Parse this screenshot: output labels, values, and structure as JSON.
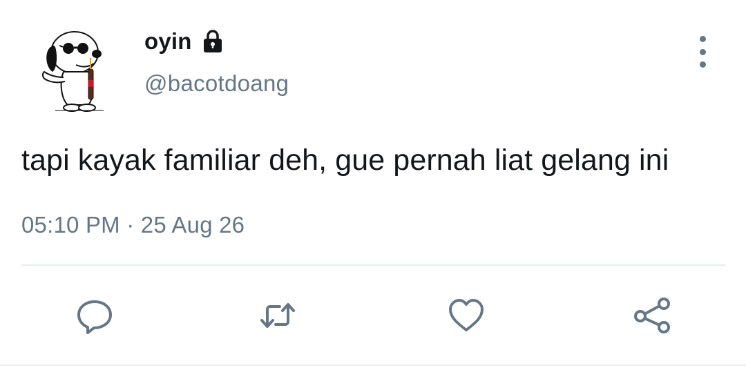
{
  "tweet": {
    "author": {
      "display_name": "oyin",
      "handle": "@bacotdoang",
      "protected": true,
      "avatar_icon": "snoopy-avatar"
    },
    "text": "tapi kayak familiar deh, gue pernah liat gelang ini",
    "timestamp": "05:10 PM · 25 Aug 26",
    "actions": {
      "reply_icon": "reply-icon",
      "retweet_icon": "retweet-icon",
      "like_icon": "heart-icon",
      "share_icon": "share-icon"
    }
  },
  "colors": {
    "text_primary": "#14171a",
    "text_secondary": "#657786",
    "divider": "#e6ecf0",
    "background": "#ffffff"
  }
}
